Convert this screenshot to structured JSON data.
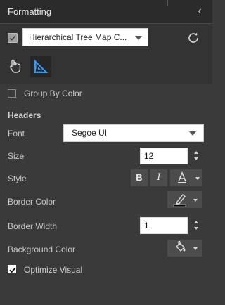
{
  "panel": {
    "title": "Formatting",
    "collapse_glyph": "‹",
    "visual_select": "Hierarchical Tree Map C...",
    "icons": {
      "collapse": "chevron-left-icon",
      "reset": "reset-icon",
      "general_tab": "paint-bucket-hand-icon",
      "format_tab": "ruler-triangle-icon"
    }
  },
  "options": {
    "group_by_color": "Group By Color",
    "optimize_visual": "Optimize Visual"
  },
  "headers": {
    "section_title": "Headers",
    "font_label": "Font",
    "font_value": "Segoe UI",
    "size_label": "Size",
    "size_value": "12",
    "style_label": "Style",
    "bold": "B",
    "italic": "I",
    "border_color_label": "Border Color",
    "border_width_label": "Border Width",
    "border_width_value": "1",
    "background_color_label": "Background Color"
  },
  "colors": {
    "panel_bg": "#3a3a3a",
    "accent": "#1e90ff",
    "border_color_swatch": "#000000"
  }
}
